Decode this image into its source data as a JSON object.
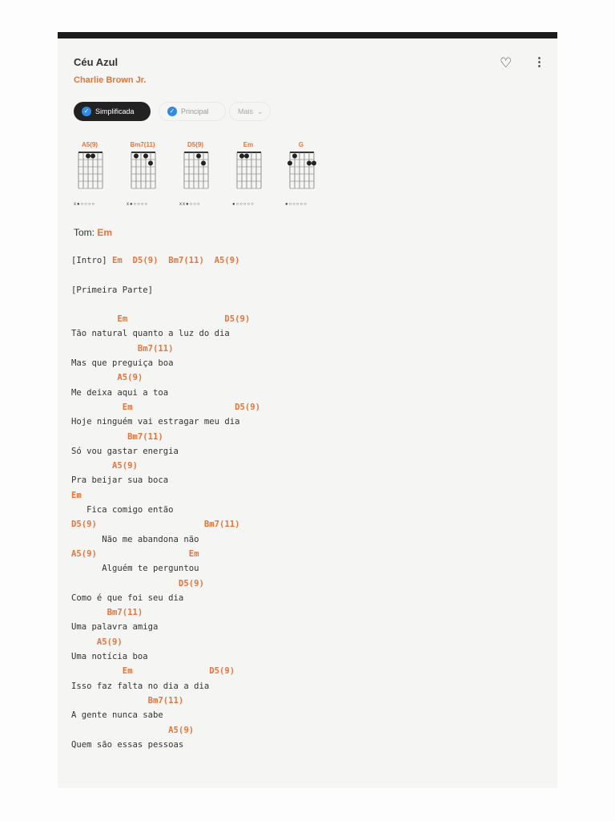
{
  "song": {
    "title": "Céu Azul",
    "artist": "Charlie Brown Jr."
  },
  "icons": {
    "favorite": "heart-outline-icon",
    "menu": "more-vertical-icon"
  },
  "versions": {
    "simplified": "Simplificada",
    "main": "Principal",
    "more": "Mais",
    "more_chevron": "⌄",
    "check": "✓"
  },
  "colors": {
    "accent": "#e8743b",
    "check": "#2f8be6"
  },
  "chord_diagrams": [
    {
      "name": "A5(9)",
      "dots": [
        [
          2,
          1
        ],
        [
          3,
          1
        ]
      ],
      "strings": "x●○○○○"
    },
    {
      "name": "Bm7(11)",
      "dots": [
        [
          1,
          1
        ],
        [
          3,
          1
        ],
        [
          4,
          2
        ]
      ],
      "strings": "x●○○○○"
    },
    {
      "name": "D5(9)",
      "dots": [
        [
          3,
          1
        ],
        [
          4,
          2
        ]
      ],
      "strings": "xx●○○○"
    },
    {
      "name": "Em",
      "dots": [
        [
          1,
          1
        ],
        [
          2,
          1
        ]
      ],
      "strings": "●○○○○○"
    },
    {
      "name": "G",
      "dots": [
        [
          0,
          2
        ],
        [
          1,
          1
        ],
        [
          4,
          2
        ],
        [
          5,
          2
        ]
      ],
      "strings": "●○○○○○"
    }
  ],
  "tom": {
    "label": "Tom:",
    "key": "Em"
  },
  "intro": {
    "label": "[Intro]",
    "chords": "Em  D5(9)  Bm7(11)  A5(9)"
  },
  "section": "[Primeira Parte]",
  "lines": [
    {
      "c": "         Em                   D5(9)"
    },
    {
      "l": "Tão natural quanto a luz do dia"
    },
    {
      "c": "             Bm7(11)"
    },
    {
      "l": "Mas que preguiça boa"
    },
    {
      "c": "         A5(9)"
    },
    {
      "l": "Me deixa aqui a toa"
    },
    {
      "c": "          Em                    D5(9)"
    },
    {
      "l": "Hoje ninguém vai estragar meu dia"
    },
    {
      "c": "           Bm7(11)"
    },
    {
      "l": "Só vou gastar energia"
    },
    {
      "c": "        A5(9)"
    },
    {
      "l": "Pra beijar sua boca"
    },
    {
      "c": "Em"
    },
    {
      "l": "   Fica comigo então"
    },
    {
      "c": "D5(9)                     Bm7(11)"
    },
    {
      "l": "      Não me abandona não"
    },
    {
      "c": "A5(9)                  Em"
    },
    {
      "l": "      Alguém te perguntou"
    },
    {
      "c": "                     D5(9)"
    },
    {
      "l": "Como é que foi seu dia"
    },
    {
      "c": "       Bm7(11)"
    },
    {
      "l": "Uma palavra amiga"
    },
    {
      "c": "     A5(9)"
    },
    {
      "l": "Uma notícia boa"
    },
    {
      "c": "          Em               D5(9)"
    },
    {
      "l": "Isso faz falta no dia a dia"
    },
    {
      "c": "               Bm7(11)"
    },
    {
      "l": "A gente nunca sabe"
    },
    {
      "c": "                   A5(9)"
    },
    {
      "l": "Quem são essas pessoas"
    }
  ]
}
